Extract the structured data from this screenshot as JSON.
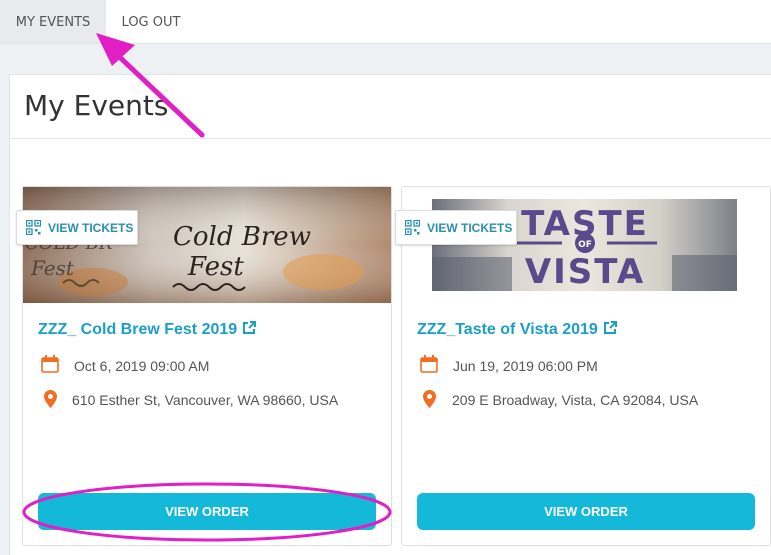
{
  "nav": {
    "tabs": [
      {
        "label": "MY EVENTS",
        "active": true
      },
      {
        "label": "LOG OUT",
        "active": false
      }
    ]
  },
  "page": {
    "title": "My Events"
  },
  "events": [
    {
      "view_tickets_label": "VIEW TICKETS",
      "title": "ZZZ_ Cold Brew Fest 2019",
      "date": "Oct 6, 2019 09:00 AM",
      "address": "610 Esther St, Vancouver, WA 98660, USA",
      "view_order_label": "VIEW ORDER",
      "hero_text": "COLD BREW FEST"
    },
    {
      "view_tickets_label": "VIEW TICKETS",
      "title": "ZZZ_Taste of Vista 2019",
      "date": "Jun 19, 2019 06:00 PM",
      "address": "209 E Broadway, Vista, CA 92084, USA",
      "view_order_label": "VIEW ORDER",
      "hero_text": {
        "top": "TASTE",
        "mid": "OF",
        "bottom": "VISTA"
      }
    }
  ],
  "colors": {
    "accent": "#14b8d8",
    "title_link": "#1a9fc9",
    "icon_orange": "#f26d21",
    "annotation": "#e01fc4"
  },
  "icons": [
    "qr-code-icon",
    "external-link-icon",
    "calendar-icon",
    "map-pin-icon"
  ]
}
